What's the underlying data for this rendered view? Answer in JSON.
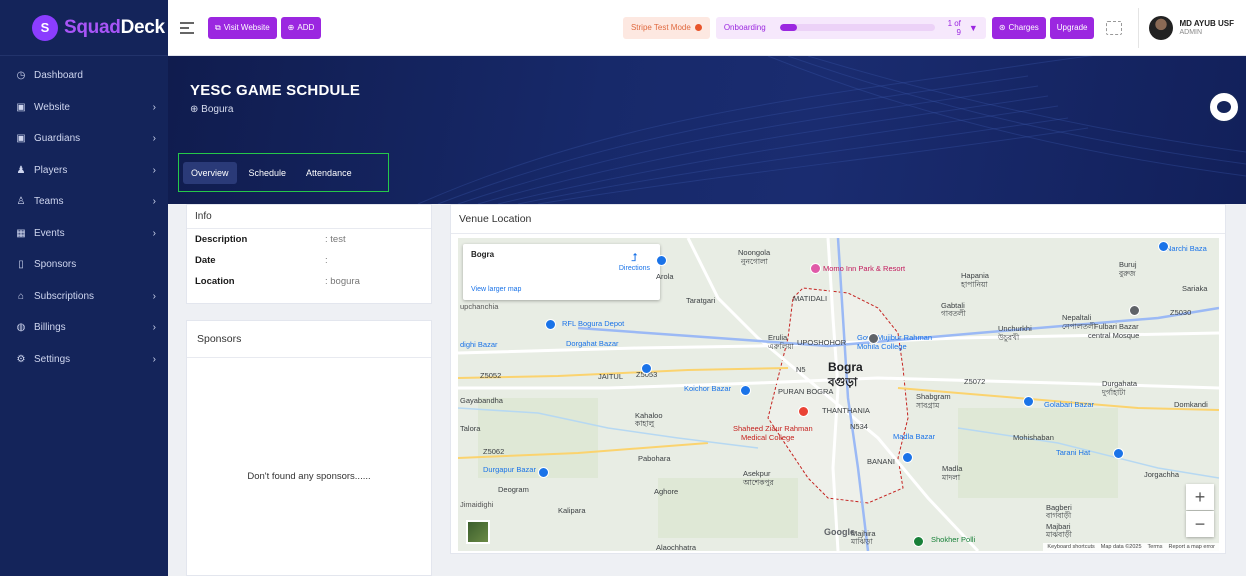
{
  "brand": {
    "part1": "Squad",
    "part2": "Deck"
  },
  "sidebar": {
    "items": [
      {
        "label": "Dashboard",
        "icon": "dashboard-icon",
        "glyph": "◷",
        "has_children": false
      },
      {
        "label": "Website",
        "icon": "website-icon",
        "glyph": "▣",
        "has_children": true
      },
      {
        "label": "Guardians",
        "icon": "guardians-icon",
        "glyph": "▣",
        "has_children": true
      },
      {
        "label": "Players",
        "icon": "players-icon",
        "glyph": "♟",
        "has_children": true
      },
      {
        "label": "Teams",
        "icon": "teams-icon",
        "glyph": "♙",
        "has_children": true
      },
      {
        "label": "Events",
        "icon": "events-icon",
        "glyph": "▦",
        "has_children": true
      },
      {
        "label": "Sponsors",
        "icon": "sponsors-icon",
        "glyph": "▯",
        "has_children": false
      },
      {
        "label": "Subscriptions",
        "icon": "subscriptions-icon",
        "glyph": "⌂",
        "has_children": true
      },
      {
        "label": "Billings",
        "icon": "billings-icon",
        "glyph": "◍",
        "has_children": true
      },
      {
        "label": "Settings",
        "icon": "settings-icon",
        "glyph": "⚙",
        "has_children": true
      }
    ]
  },
  "topbar": {
    "visit_website": "Visit Website",
    "add": "ADD",
    "stripe_mode": "Stripe Test Mode",
    "onboarding_label": "Onboarding",
    "onboarding_count": "1 of 9",
    "onboarding_progress": 0.11,
    "charges": "Charges",
    "upgrade": "Upgrade",
    "user_name": "MD AYUB USF",
    "user_role": "ADMIN"
  },
  "event": {
    "title": "YESC GAME SCHDULE",
    "location": "Bogura",
    "tabs": [
      {
        "label": "Overview",
        "active": true
      },
      {
        "label": "Schedule",
        "active": false
      },
      {
        "label": "Attendance",
        "active": false
      }
    ]
  },
  "info": {
    "heading": "Info",
    "rows": [
      {
        "key": "Description",
        "value": ": test"
      },
      {
        "key": "Date",
        "value": ":"
      },
      {
        "key": "Location",
        "value": ": bogura"
      }
    ]
  },
  "sponsors": {
    "heading": "Sponsors",
    "empty": "Don't found any sponsors......"
  },
  "venue": {
    "heading": "Venue Location",
    "place_name": "Bogra",
    "directions": "Directions",
    "larger_map": "View larger map",
    "footer": [
      "Keyboard shortcuts",
      "Map data ©2025",
      "Terms",
      "Report a map error"
    ],
    "google": "Google",
    "labels": [
      {
        "text": "Noongola",
        "cls": ""
      },
      {
        "text": "নুনগোলা",
        "cls": ""
      },
      {
        "text": "Arola",
        "cls": ""
      },
      {
        "text": "Momo Inn Park & Resort",
        "cls": "poi-pink"
      },
      {
        "text": "Hapania",
        "cls": ""
      },
      {
        "text": "হাপানিয়া",
        "cls": ""
      },
      {
        "text": "Buruj",
        "cls": ""
      },
      {
        "text": "বুরুজ",
        "cls": ""
      },
      {
        "text": "Narchi Baza",
        "cls": "poi-blue"
      },
      {
        "text": "Sariaka",
        "cls": ""
      },
      {
        "text": "Taratgari",
        "cls": ""
      },
      {
        "text": "MATIDALI",
        "cls": ""
      },
      {
        "text": "Gabtali",
        "cls": ""
      },
      {
        "text": "গাবতলী",
        "cls": ""
      },
      {
        "text": "Nepaltali",
        "cls": ""
      },
      {
        "text": "নেপালতলী",
        "cls": ""
      },
      {
        "text": "upchanchia",
        "cls": "cut"
      },
      {
        "text": "RFL Bogura Depot",
        "cls": "poi-blue"
      },
      {
        "text": "Govt. Mujibur Rahman",
        "cls": "poi-blue"
      },
      {
        "text": "Mohila College",
        "cls": "poi-blue"
      },
      {
        "text": "Unchurkhi",
        "cls": ""
      },
      {
        "text": "উচুরখী",
        "cls": ""
      },
      {
        "text": "Fulbari Bazar",
        "cls": ""
      },
      {
        "text": "central Mosque",
        "cls": ""
      },
      {
        "text": "dighi Bazar",
        "cls": "poi-blue"
      },
      {
        "text": "Dorgahat Bazar",
        "cls": "poi-blue"
      },
      {
        "text": "Erulia",
        "cls": ""
      },
      {
        "text": "এরুলিয়া",
        "cls": ""
      },
      {
        "text": "UPOSHOHOR",
        "cls": ""
      },
      {
        "text": "Bogra",
        "cls": "big"
      },
      {
        "text": "বগুড়া",
        "cls": "big"
      },
      {
        "text": "JAITUL",
        "cls": ""
      },
      {
        "text": "Koichor Bazar",
        "cls": "poi-blue"
      },
      {
        "text": "PURAN BOGRA",
        "cls": ""
      },
      {
        "text": "Durgahata",
        "cls": ""
      },
      {
        "text": "দুর্গাহাটা",
        "cls": ""
      },
      {
        "text": "Gayabandha",
        "cls": ""
      },
      {
        "text": "Shabgram",
        "cls": ""
      },
      {
        "text": "সাবগ্রাম",
        "cls": ""
      },
      {
        "text": "Golabari Bazar",
        "cls": "poi-blue"
      },
      {
        "text": "Domkandi",
        "cls": ""
      },
      {
        "text": "Kahaloo",
        "cls": ""
      },
      {
        "text": "কাহালু",
        "cls": ""
      },
      {
        "text": "THANTHANIA",
        "cls": ""
      },
      {
        "text": "Talora",
        "cls": ""
      },
      {
        "text": "Shaheed Ziaur Rahman",
        "cls": "poi-red"
      },
      {
        "text": "Medical College",
        "cls": "poi-red"
      },
      {
        "text": "Madla Bazar",
        "cls": "poi-blue"
      },
      {
        "text": "Mohishaban",
        "cls": ""
      },
      {
        "text": "Tarani Hat",
        "cls": "poi-blue"
      },
      {
        "text": "Pabohara",
        "cls": ""
      },
      {
        "text": "BANANI",
        "cls": ""
      },
      {
        "text": "Madla",
        "cls": ""
      },
      {
        "text": "মাদলা",
        "cls": ""
      },
      {
        "text": "Jorgachha",
        "cls": ""
      },
      {
        "text": "Durgapur Bazar",
        "cls": "poi-blue"
      },
      {
        "text": "Asekpur",
        "cls": ""
      },
      {
        "text": "আশেকপুর",
        "cls": ""
      },
      {
        "text": "Deogram",
        "cls": ""
      },
      {
        "text": "Aghore",
        "cls": ""
      },
      {
        "text": "Bagberi",
        "cls": ""
      },
      {
        "text": "বাগবাড়ী",
        "cls": ""
      },
      {
        "text": "Jimaidighi",
        "cls": "cut"
      },
      {
        "text": "Kalipara",
        "cls": ""
      },
      {
        "text": "Majbari",
        "cls": ""
      },
      {
        "text": "মাঝবাড়ী",
        "cls": ""
      },
      {
        "text": "Majhira",
        "cls": ""
      },
      {
        "text": "মাঝিড়া",
        "cls": ""
      },
      {
        "text": "Shokher Polli",
        "cls": "poi-green"
      },
      {
        "text": "Alaochhatra",
        "cls": ""
      },
      {
        "text": "Z5052",
        "cls": ""
      },
      {
        "text": "Z5053",
        "cls": ""
      },
      {
        "text": "Z5062",
        "cls": ""
      },
      {
        "text": "Z5072",
        "cls": ""
      },
      {
        "text": "Z5030",
        "cls": ""
      },
      {
        "text": "N5",
        "cls": ""
      },
      {
        "text": "N534",
        "cls": ""
      }
    ]
  },
  "colors": {
    "sidebar": "#14245a",
    "accent": "#9b27e0",
    "hero": "#17296a",
    "tab_outline": "#25c84a"
  }
}
